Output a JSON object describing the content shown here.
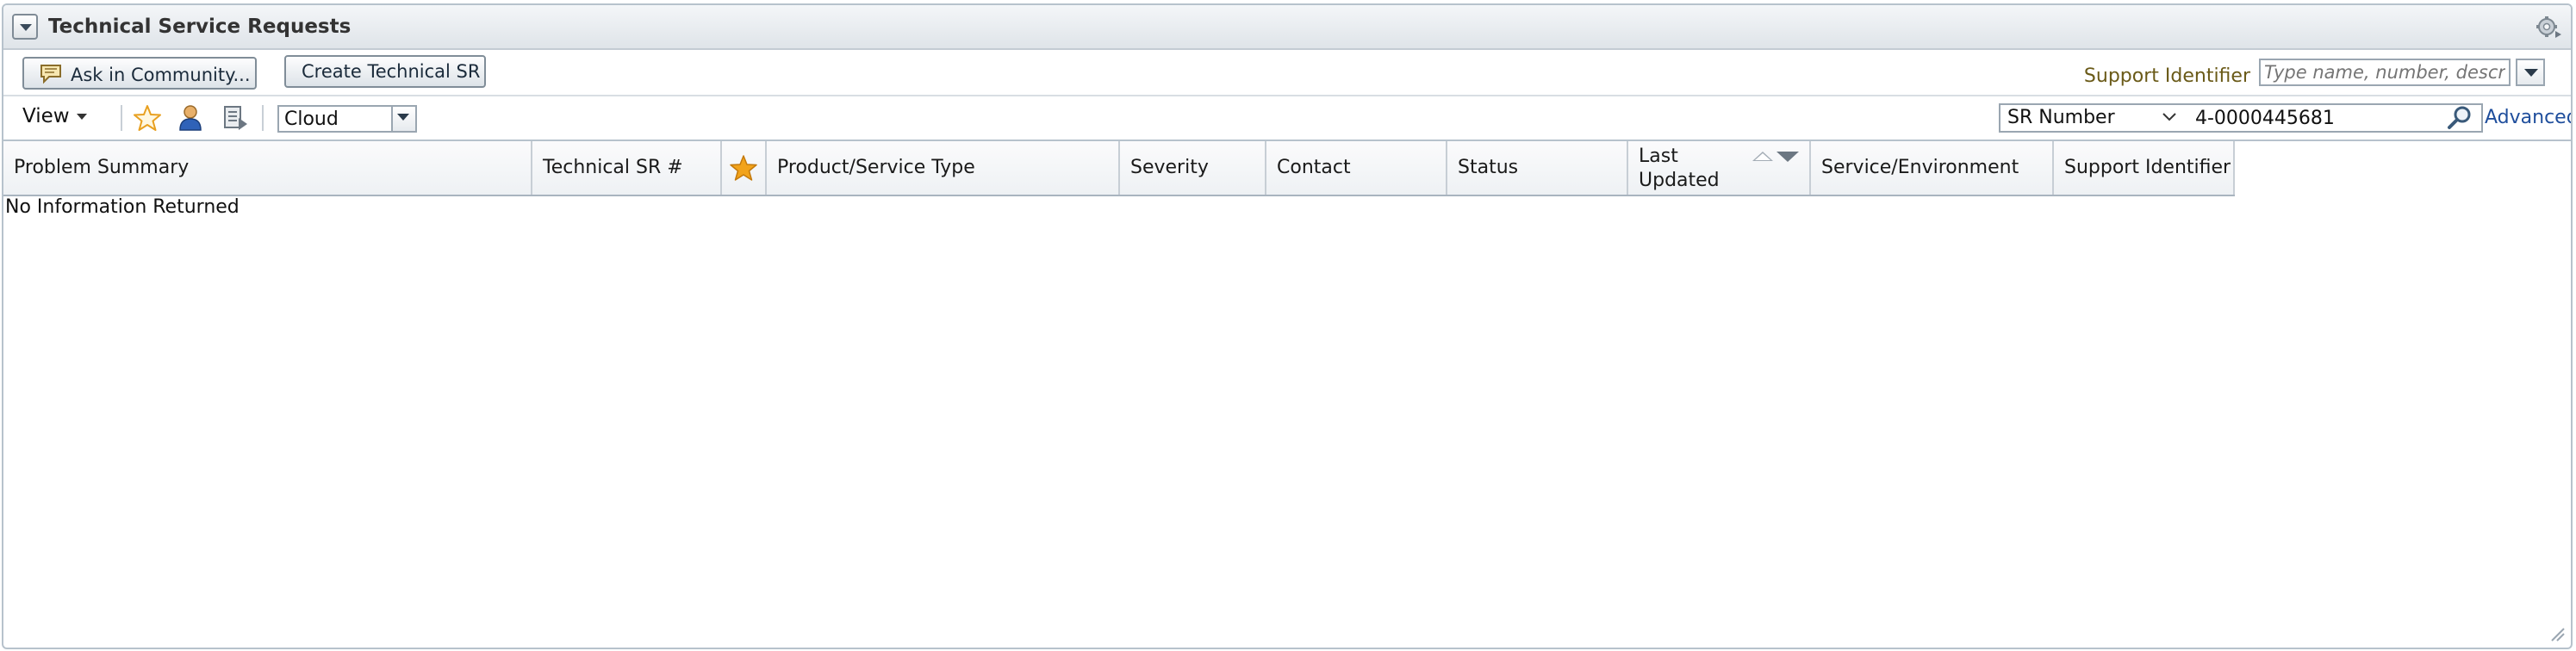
{
  "panel": {
    "title": "Technical Service Requests",
    "icons": {
      "collapse": "chevron-down-icon",
      "settings": "gear-icon"
    }
  },
  "toolbar": {
    "ask_community_label": "Ask in Community...",
    "create_sr_label": "Create Technical SR",
    "support_identifier_label": "Support Identifier",
    "support_identifier_placeholder": "Type name, number, descri",
    "view_label": "View",
    "filter_value": "Cloud",
    "search_field": "SR Number",
    "search_value": "4-0000445681",
    "advanced_label": "Advanced"
  },
  "table": {
    "columns": [
      "Problem Summary",
      "Technical SR #",
      "",
      "Product/Service Type",
      "Severity",
      "Contact",
      "Status",
      "Last Updated",
      "Service/Environment",
      "Support Identifier"
    ],
    "last_updated_line1": "Last",
    "last_updated_line2": "Updated",
    "sorted_column": "Last Updated",
    "sort_direction": "descending",
    "empty_message": "No Information Returned"
  },
  "colors": {
    "accent_link": "#1f4e9c",
    "support_label": "#6a5a18",
    "favorite_star": "#f2a31b"
  }
}
